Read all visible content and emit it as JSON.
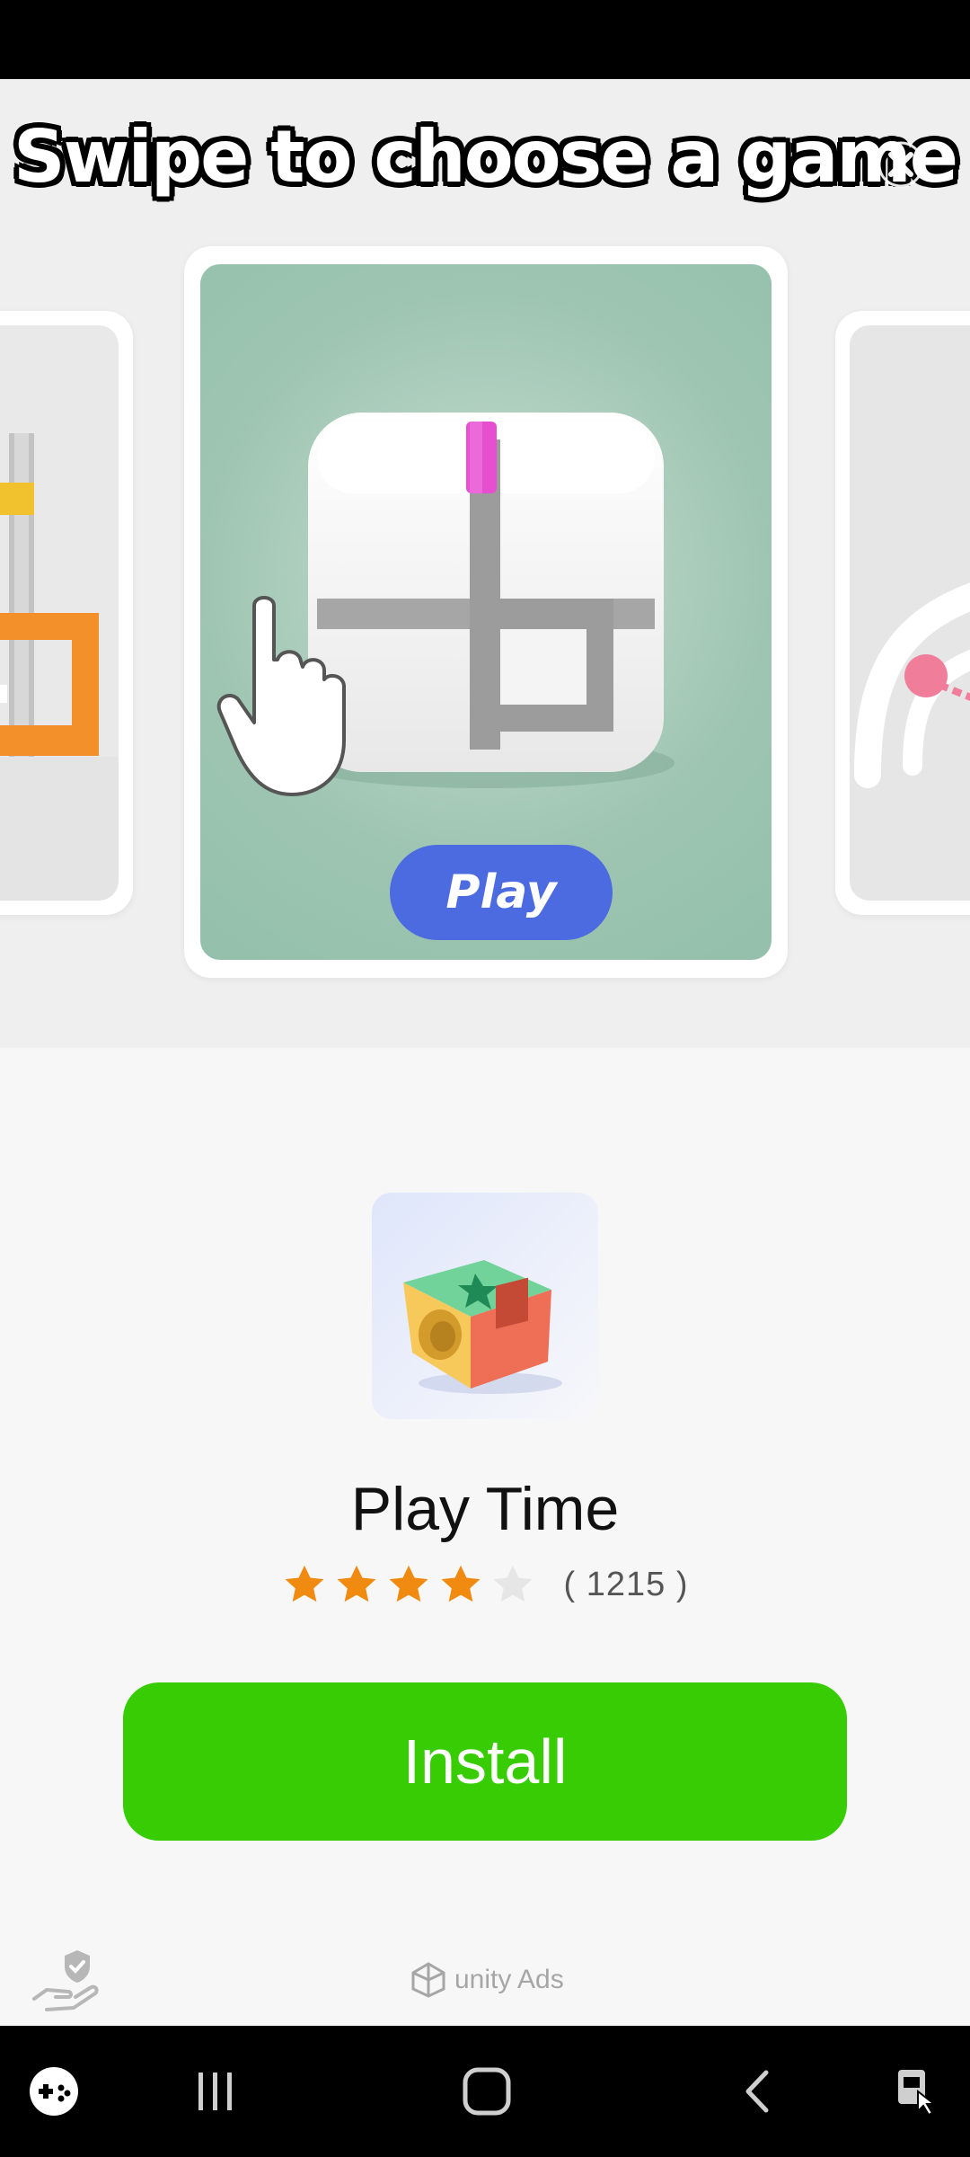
{
  "banner": {
    "title": "Swipe to choose a game"
  },
  "carousel": {
    "play_label": "Play"
  },
  "app": {
    "name": "Play Time",
    "rating": {
      "value": 4,
      "max": 5,
      "count_text": "( 1215 )"
    }
  },
  "install": {
    "label": "Install"
  },
  "footer": {
    "brand": "unity Ads"
  },
  "nav": {
    "items": [
      "game-launcher-icon",
      "recent-apps-icon",
      "home-icon",
      "back-icon",
      "accessibility-icon"
    ]
  },
  "colors": {
    "install": "#38cc04",
    "play": "#4d6be0",
    "star_filled": "#f08a10",
    "star_empty": "#e6e6e6",
    "card_center_bg": "#9ec5b2"
  }
}
